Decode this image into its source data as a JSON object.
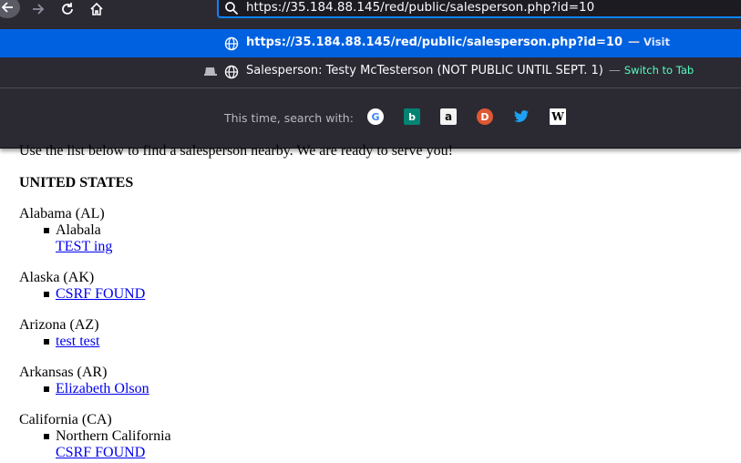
{
  "browser": {
    "url_value": "https://35.184.88.145/red/public/salesperson.php?id=10"
  },
  "dropdown": {
    "selected": {
      "url": "https://35.184.88.145/red/public/salesperson.php?id=10",
      "separator": "—",
      "action": "Visit"
    },
    "second": {
      "title": "Salesperson: Testy McTesterson (NOT PUBLIC UNTIL SEPT. 1)",
      "separator": "—",
      "action": "Switch to Tab"
    },
    "search_label": "This time, search with:",
    "engines": [
      {
        "name": "google",
        "icon": "google-icon",
        "glyph": "G"
      },
      {
        "name": "bing",
        "icon": "bing-icon",
        "glyph": "b"
      },
      {
        "name": "amazon",
        "icon": "amazon-icon",
        "glyph": "a"
      },
      {
        "name": "duckduckgo",
        "icon": "duckduckgo-icon",
        "glyph": "D"
      },
      {
        "name": "twitter",
        "icon": "twitter-icon",
        "glyph": "🐦"
      },
      {
        "name": "wikipedia",
        "icon": "wikipedia-icon",
        "glyph": "W"
      }
    ]
  },
  "page": {
    "intro": "Use the list below to find a salesperson nearby. We are ready to serve you!",
    "country": "UNITED STATES",
    "states": [
      {
        "name": "Alabama (AL)",
        "region": "Alabala",
        "link": "TEST ing"
      },
      {
        "name": "Alaska (AK)",
        "link": "CSRF FOUND"
      },
      {
        "name": "Arizona (AZ)",
        "link": "test test"
      },
      {
        "name": "Arkansas (AR)",
        "link": "Elizabeth Olson"
      },
      {
        "name": "California (CA)",
        "region": "Northern California",
        "link": "CSRF FOUND"
      }
    ]
  },
  "colors": {
    "chrome_bg": "#2b2a33",
    "selected_row": "#0061e0",
    "url_focus_border": "#0a84ff",
    "switch_to_tab": "#54ffbd",
    "link": "#0000ee"
  }
}
